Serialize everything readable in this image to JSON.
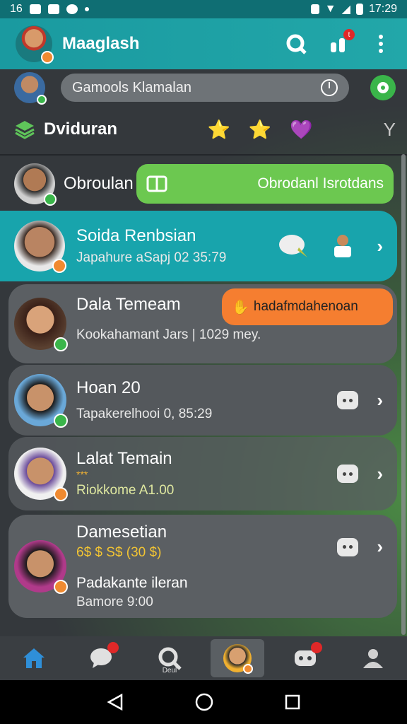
{
  "status": {
    "time": "17:29",
    "left_label": "16"
  },
  "appbar": {
    "title": "Maaglash",
    "notif_count": "t"
  },
  "search": {
    "text": "Gamools Klamalan"
  },
  "category": {
    "label": "Dviduran",
    "emojis": [
      "⭐",
      "⭐",
      "💜"
    ],
    "filter": "Y"
  },
  "featured": {
    "name": "Obroulan",
    "pill_text": "Obrodanl Isrotdans"
  },
  "chats": [
    {
      "name": "Soida Renbsian",
      "sub": "Japahure aSapj 02 35:79"
    },
    {
      "name": "Dala Temeam",
      "sub": "Kookahamant Jars | 1029 mey.",
      "action": "hadafmdahenoan"
    },
    {
      "name": "Hoan 20",
      "sub": "Tapakerelhooi 0, 85:29"
    },
    {
      "name": "Lalat Temain",
      "stars": "***",
      "sub": "Riokkome A1.00"
    },
    {
      "name": "Damesetian",
      "tag": "6$ $ S$ (30 $)",
      "sub2": "Padakante ileran",
      "sub": "Bamore 9:00"
    }
  ],
  "bottomnav": {
    "search_label": "Deul",
    "chat_count": "",
    "game_count": ""
  },
  "colors": {
    "teal": "#1a9aa0",
    "green": "#6cc850",
    "orange": "#f57e30"
  }
}
